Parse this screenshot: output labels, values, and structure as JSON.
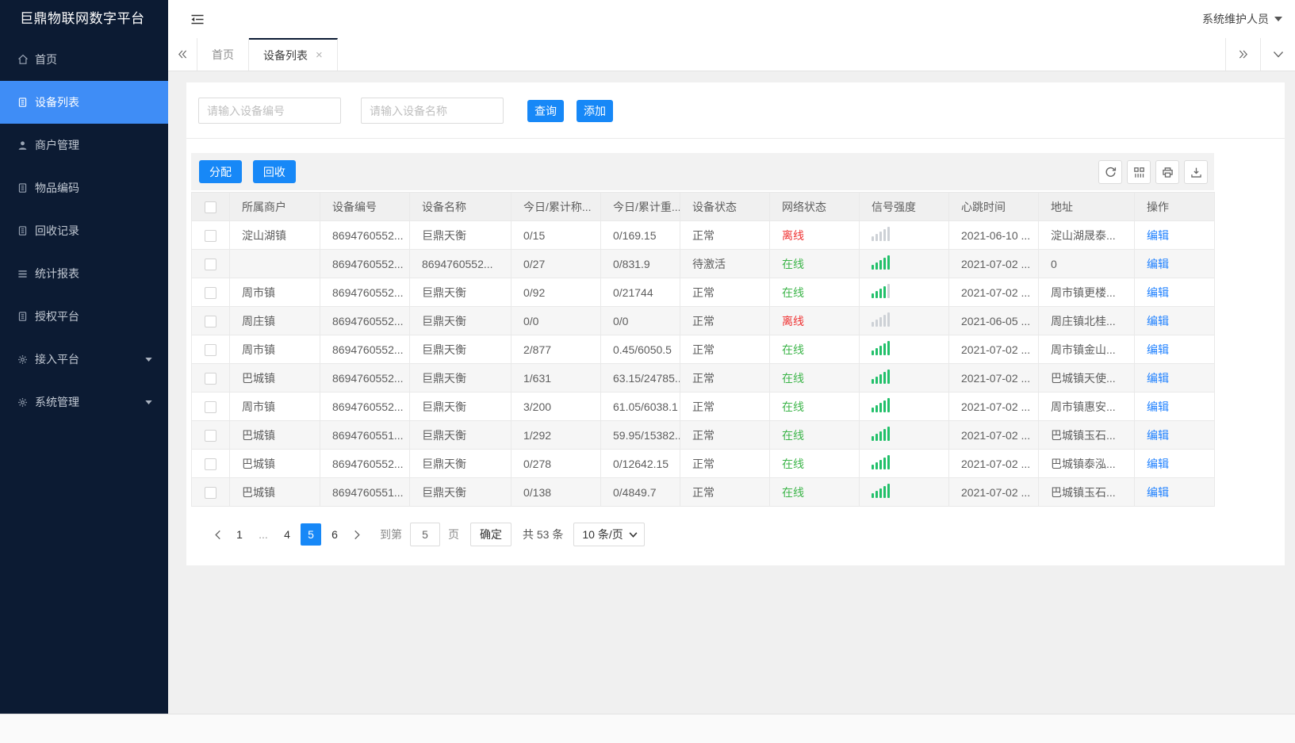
{
  "app": {
    "title": "巨鼎物联网数字平台",
    "user": "系统维护人员"
  },
  "colors": {
    "accent": "#1788f7",
    "sidebar_bg": "#0c1b33",
    "sidebar_active": "#3f8df6",
    "online_green": "#3db54a",
    "offline_red": "#ef3333",
    "signal_green": "#22c06a",
    "signal_gray": "#cdd1d6",
    "link_blue": "#1e80ff"
  },
  "sidebar": {
    "items": [
      {
        "id": "home",
        "label": "首页",
        "icon": "home-icon",
        "active": false,
        "expandable": false
      },
      {
        "id": "device-list",
        "label": "设备列表",
        "icon": "doc-icon",
        "active": true,
        "expandable": false
      },
      {
        "id": "merchant-management",
        "label": "商户管理",
        "icon": "user-icon",
        "active": false,
        "expandable": false
      },
      {
        "id": "item-coding",
        "label": "物品编码",
        "icon": "doc-icon",
        "active": false,
        "expandable": false
      },
      {
        "id": "recycle-records",
        "label": "回收记录",
        "icon": "doc-icon",
        "active": false,
        "expandable": false
      },
      {
        "id": "statistics-report",
        "label": "统计报表",
        "icon": "lines-icon",
        "active": false,
        "expandable": false
      },
      {
        "id": "authorization-platform",
        "label": "授权平台",
        "icon": "doc-icon",
        "active": false,
        "expandable": false
      },
      {
        "id": "access-platform",
        "label": "接入平台",
        "icon": "gear-icon",
        "active": false,
        "expandable": true
      },
      {
        "id": "system-management",
        "label": "系统管理",
        "icon": "gear-icon",
        "active": false,
        "expandable": true
      }
    ]
  },
  "tabs": {
    "items": [
      {
        "id": "home",
        "label": "首页",
        "active": false
      },
      {
        "id": "device-list",
        "label": "设备列表",
        "active": true,
        "close": "×"
      }
    ]
  },
  "search": {
    "device_no_placeholder": "请输入设备编号",
    "device_name_placeholder": "请输入设备名称",
    "query_label": "查询",
    "add_label": "添加"
  },
  "toolbar": {
    "allocate_label": "分配",
    "recycle_label": "回收",
    "icons": [
      "refresh-icon",
      "columns-icon",
      "print-icon",
      "export-icon"
    ]
  },
  "table": {
    "headers": [
      "所属商户",
      "设备编号",
      "设备名称",
      "今日/累计称...",
      "今日/累计重...",
      "设备状态",
      "网络状态",
      "信号强度",
      "心跳时间",
      "地址",
      "操作"
    ],
    "rows": [
      {
        "merchant": "淀山湖镇",
        "device_no": "8694760552...",
        "device_name": "巨鼎天衡",
        "today_count": "0/15",
        "today_weight": "0/169.15",
        "device_status": "正常",
        "network_status": "离线",
        "signal_level": 0,
        "heartbeat": "2021-06-10 ...",
        "address": "淀山湖晟泰...",
        "action": "编辑"
      },
      {
        "merchant": "",
        "device_no": "8694760552...",
        "device_name": "8694760552...",
        "today_count": "0/27",
        "today_weight": "0/831.9",
        "device_status": "待激活",
        "network_status": "在线",
        "signal_level": 5,
        "heartbeat": "2021-07-02 ...",
        "address": "0",
        "action": "编辑"
      },
      {
        "merchant": "周市镇",
        "device_no": "8694760552...",
        "device_name": "巨鼎天衡",
        "today_count": "0/92",
        "today_weight": "0/21744",
        "device_status": "正常",
        "network_status": "在线",
        "signal_level": 4,
        "heartbeat": "2021-07-02 ...",
        "address": "周市镇更楼...",
        "action": "编辑"
      },
      {
        "merchant": "周庄镇",
        "device_no": "8694760552...",
        "device_name": "巨鼎天衡",
        "today_count": "0/0",
        "today_weight": "0/0",
        "device_status": "正常",
        "network_status": "离线",
        "signal_level": 0,
        "heartbeat": "2021-06-05 ...",
        "address": "周庄镇北桂...",
        "action": "编辑"
      },
      {
        "merchant": "周市镇",
        "device_no": "8694760552...",
        "device_name": "巨鼎天衡",
        "today_count": "2/877",
        "today_weight": "0.45/6050.5",
        "device_status": "正常",
        "network_status": "在线",
        "signal_level": 5,
        "heartbeat": "2021-07-02 ...",
        "address": "周市镇金山...",
        "action": "编辑"
      },
      {
        "merchant": "巴城镇",
        "device_no": "8694760552...",
        "device_name": "巨鼎天衡",
        "today_count": "1/631",
        "today_weight": "63.15/24785...",
        "device_status": "正常",
        "network_status": "在线",
        "signal_level": 5,
        "heartbeat": "2021-07-02 ...",
        "address": "巴城镇天使...",
        "action": "编辑"
      },
      {
        "merchant": "周市镇",
        "device_no": "8694760552...",
        "device_name": "巨鼎天衡",
        "today_count": "3/200",
        "today_weight": "61.05/6038.1",
        "device_status": "正常",
        "network_status": "在线",
        "signal_level": 5,
        "heartbeat": "2021-07-02 ...",
        "address": "周市镇惠安...",
        "action": "编辑"
      },
      {
        "merchant": "巴城镇",
        "device_no": "8694760551...",
        "device_name": "巨鼎天衡",
        "today_count": "1/292",
        "today_weight": "59.95/15382...",
        "device_status": "正常",
        "network_status": "在线",
        "signal_level": 5,
        "heartbeat": "2021-07-02 ...",
        "address": "巴城镇玉石...",
        "action": "编辑"
      },
      {
        "merchant": "巴城镇",
        "device_no": "8694760552...",
        "device_name": "巨鼎天衡",
        "today_count": "0/278",
        "today_weight": "0/12642.15",
        "device_status": "正常",
        "network_status": "在线",
        "signal_level": 5,
        "heartbeat": "2021-07-02 ...",
        "address": "巴城镇泰泓...",
        "action": "编辑"
      },
      {
        "merchant": "巴城镇",
        "device_no": "8694760551...",
        "device_name": "巨鼎天衡",
        "today_count": "0/138",
        "today_weight": "0/4849.7",
        "device_status": "正常",
        "network_status": "在线",
        "signal_level": 5,
        "heartbeat": "2021-07-02 ...",
        "address": "巴城镇玉石...",
        "action": "编辑"
      }
    ]
  },
  "pagination": {
    "pages": [
      {
        "label": "1",
        "active": false
      },
      {
        "label": "...",
        "active": false
      },
      {
        "label": "4",
        "active": false
      },
      {
        "label": "5",
        "active": true
      },
      {
        "label": "6",
        "active": false
      }
    ],
    "goto_label": "到第",
    "goto_value": "5",
    "page_label": "页",
    "confirm_label": "确定",
    "total_label": "共 53 条",
    "page_size": "10 条/页"
  }
}
